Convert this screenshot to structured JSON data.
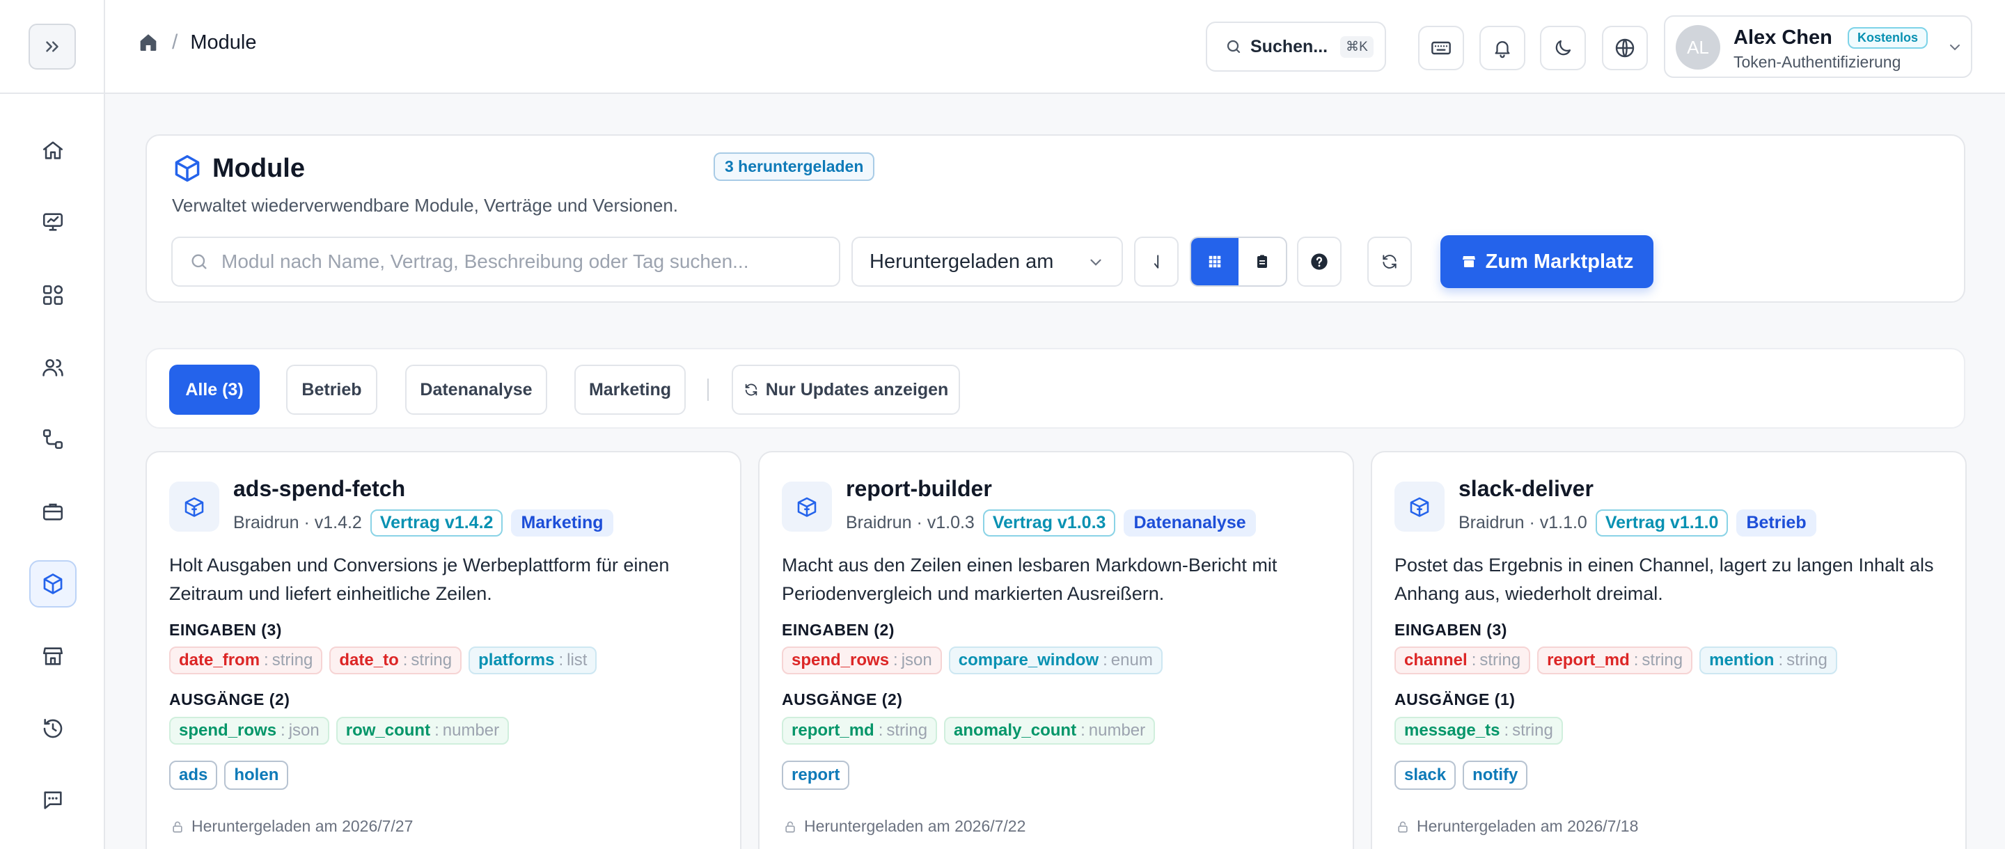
{
  "header": {
    "breadcrumb_current": "Module",
    "search_label": "Suchen...",
    "search_shortcut": "⌘K",
    "user": {
      "initials": "AL",
      "name": "Alex Chen",
      "plan": "Kostenlos",
      "auth": "Token-Authentifizierung"
    }
  },
  "sidebar": {
    "items": [
      {
        "icon": "home-icon"
      },
      {
        "icon": "monitor-chart-icon"
      },
      {
        "icon": "apps-grid-icon"
      },
      {
        "icon": "users-icon"
      },
      {
        "icon": "workflow-icon"
      },
      {
        "icon": "briefcase-icon"
      },
      {
        "icon": "cube-icon",
        "active": true
      },
      {
        "icon": "store-icon"
      },
      {
        "icon": "history-icon"
      },
      {
        "icon": "chat-icon"
      }
    ]
  },
  "hero": {
    "title": "Module",
    "badge": "3 heruntergeladen",
    "subtitle": "Verwaltet wiederverwendbare Module, Verträge und Versionen.",
    "search_placeholder": "Modul nach Name, Vertrag, Beschreibung oder Tag suchen...",
    "sort_value": "Heruntergeladen am",
    "marketplace_label": "Zum Marktplatz"
  },
  "filters": {
    "all": "Alle (3)",
    "betrieb": "Betrieb",
    "datenanalyse": "Datenanalyse",
    "marketing": "Marketing",
    "updates_only": "Nur Updates anzeigen"
  },
  "labels": {
    "sep_dot": " · ",
    "inputs_prefix": "EINGABEN",
    "outputs_prefix": "AUSGÄNGE",
    "downloaded_prefix": "Heruntergeladen am"
  },
  "colors": {
    "accent": "#2463eb",
    "cyan": "#0891b2",
    "red": "#dc2626",
    "green": "#059669"
  },
  "modules": [
    {
      "name": "ads-spend-fetch",
      "publisher": "Braidrun",
      "version": "v1.4.2",
      "contract": "Vertrag v1.4.2",
      "category": "Marketing",
      "description": "Holt Ausgaben und Conversions je Werbeplattform für einen Zeitraum und liefert einheitliche Zeilen.",
      "inputs_label": "EINGABEN (3)",
      "inputs": [
        {
          "name": "date_from",
          "type": "string",
          "color": "red"
        },
        {
          "name": "date_to",
          "type": "string",
          "color": "red"
        },
        {
          "name": "platforms",
          "type": "list",
          "color": "blue"
        }
      ],
      "outputs_label": "AUSGÄNGE (2)",
      "outputs": [
        {
          "name": "spend_rows",
          "type": "json"
        },
        {
          "name": "row_count",
          "type": "number"
        }
      ],
      "tags": [
        "ads",
        "holen"
      ],
      "downloaded": "Heruntergeladen am 2026/7/27"
    },
    {
      "name": "report-builder",
      "publisher": "Braidrun",
      "version": "v1.0.3",
      "contract": "Vertrag v1.0.3",
      "category": "Datenanalyse",
      "description": "Macht aus den Zeilen einen lesbaren Markdown-Bericht mit Periodenvergleich und markierten Ausreißern.",
      "inputs_label": "EINGABEN (2)",
      "inputs": [
        {
          "name": "spend_rows",
          "type": "json",
          "color": "red"
        },
        {
          "name": "compare_window",
          "type": "enum",
          "color": "blue"
        }
      ],
      "outputs_label": "AUSGÄNGE (2)",
      "outputs": [
        {
          "name": "report_md",
          "type": "string"
        },
        {
          "name": "anomaly_count",
          "type": "number"
        }
      ],
      "tags": [
        "report"
      ],
      "downloaded": "Heruntergeladen am 2026/7/22"
    },
    {
      "name": "slack-deliver",
      "publisher": "Braidrun",
      "version": "v1.1.0",
      "contract": "Vertrag v1.1.0",
      "category": "Betrieb",
      "description": "Postet das Ergebnis in einen Channel, lagert zu langen Inhalt als Anhang aus, wiederholt dreimal.",
      "inputs_label": "EINGABEN (3)",
      "inputs": [
        {
          "name": "channel",
          "type": "string",
          "color": "red"
        },
        {
          "name": "report_md",
          "type": "string",
          "color": "red"
        },
        {
          "name": "mention",
          "type": "string",
          "color": "blue"
        }
      ],
      "outputs_label": "AUSGÄNGE (1)",
      "outputs": [
        {
          "name": "message_ts",
          "type": "string"
        }
      ],
      "tags": [
        "slack",
        "notify"
      ],
      "downloaded": "Heruntergeladen am 2026/7/18"
    }
  ]
}
